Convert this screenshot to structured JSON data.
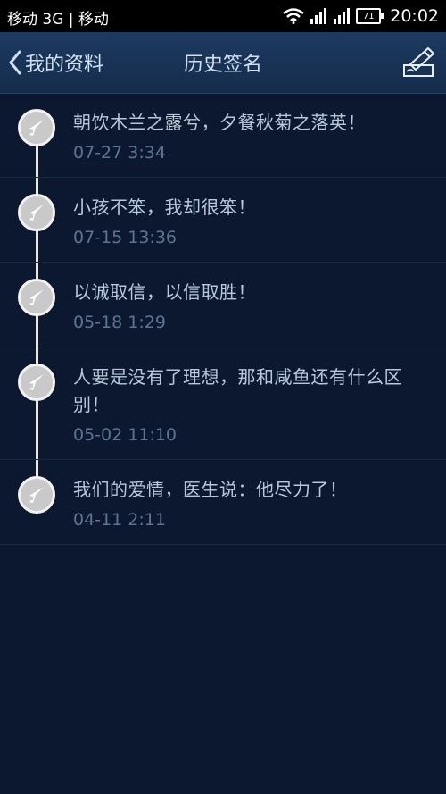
{
  "status_bar": {
    "carrier": "移动 3G | 移动",
    "battery": "71",
    "time": "20:02"
  },
  "header": {
    "back_label": "我的资料",
    "title": "历史签名"
  },
  "signatures": [
    {
      "text": "朝饮木兰之露兮，夕餐秋菊之落英！",
      "time": "07-27 3:34"
    },
    {
      "text": "小孩不笨，我却很笨！",
      "time": "07-15 13:36"
    },
    {
      "text": "以诚取信，以信取胜！",
      "time": "05-18 1:29"
    },
    {
      "text": "人要是没有了理想，那和咸鱼还有什么区别！",
      "time": "05-02 11:10"
    },
    {
      "text": "我们的爱情，医生说：他尽力了！",
      "time": "04-11 2:11"
    }
  ],
  "colors": {
    "background": "#0b1830",
    "header": "#1a345a",
    "text": "#b9c8d9",
    "timestamp": "#5e7591"
  },
  "icons": [
    "back-chevron-icon",
    "edit-signature-icon",
    "pen-nib-icon",
    "wifi-icon",
    "signal-icon",
    "battery-icon"
  ]
}
